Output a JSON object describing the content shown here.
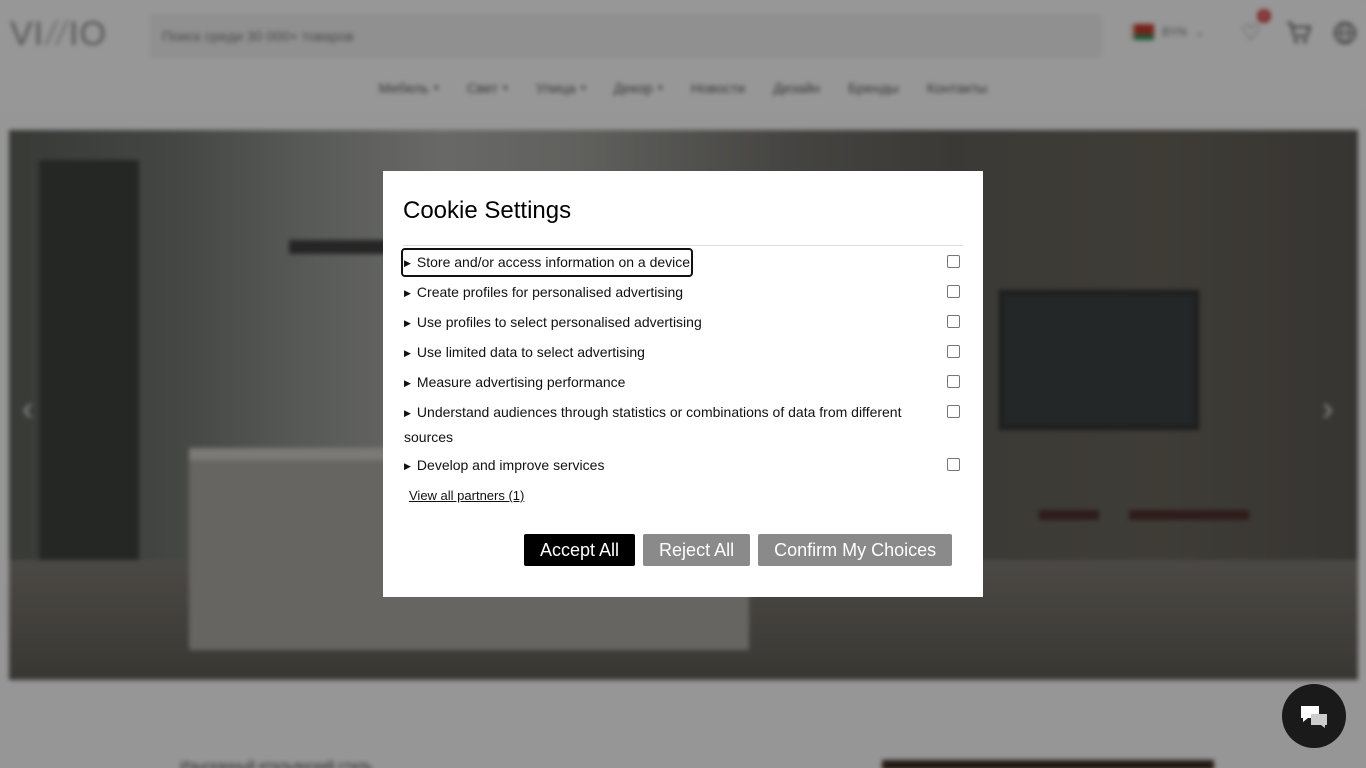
{
  "site": {
    "logo_text_left": "VI",
    "logo_text_right": "IO",
    "search_placeholder": "Поиск среди 30 000+ товаров",
    "currency": "BYN",
    "wishlist_count": "0",
    "nav": [
      {
        "label": "Мебель",
        "dropdown": true
      },
      {
        "label": "Свет",
        "dropdown": true
      },
      {
        "label": "Улица",
        "dropdown": true
      },
      {
        "label": "Декор",
        "dropdown": true
      },
      {
        "label": "Новости",
        "dropdown": false
      },
      {
        "label": "Дизайн",
        "dropdown": false
      },
      {
        "label": "Бренды",
        "dropdown": false
      },
      {
        "label": "Контакты",
        "dropdown": false
      }
    ],
    "below_text": "Изысканный итальянский стиль"
  },
  "cookie_modal": {
    "title": "Cookie Settings",
    "purposes": [
      {
        "label": "Store and/or access information on a device",
        "checked": false,
        "focused": true
      },
      {
        "label": "Create profiles for personalised advertising",
        "checked": false
      },
      {
        "label": "Use profiles to select personalised advertising",
        "checked": false
      },
      {
        "label": "Use limited data to select advertising",
        "checked": false
      },
      {
        "label": "Measure advertising performance",
        "checked": false
      },
      {
        "label": "Understand audiences through statistics or combinations of data from different sources",
        "checked": false
      },
      {
        "label": "Develop and improve services",
        "checked": false
      }
    ],
    "partners_link": "View all partners (1)",
    "buttons": {
      "accept": "Accept All",
      "reject": "Reject All",
      "confirm": "Confirm My Choices"
    },
    "colors": {
      "accept_bg": "#000000",
      "secondary_bg": "#8a8a8a"
    }
  }
}
